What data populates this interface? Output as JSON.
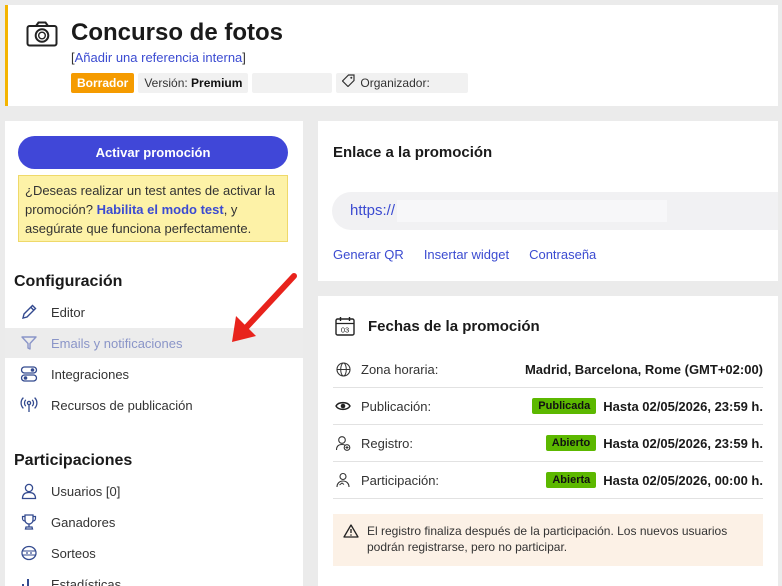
{
  "header": {
    "title": "Concurso de fotos",
    "ref_open": "[",
    "ref_link": "Añadir una referencia interna",
    "ref_close": "]",
    "badge_status": "Borrador",
    "version_label": "Versión:",
    "version_value": "Premium",
    "organizer_label": "Organizador:"
  },
  "sidebar": {
    "activate_button": "Activar promoción",
    "notice_text_1": "¿Deseas realizar un test antes de activar la promoción?",
    "notice_link": "Habilita el modo test",
    "notice_text_2": ", y asegúrate que funciona perfectamente.",
    "config_title": "Configuración",
    "config_items": [
      {
        "label": "Editor",
        "icon": "pencil-icon"
      },
      {
        "label": "Emails y notificaciones",
        "icon": "send-icon"
      },
      {
        "label": "Integraciones",
        "icon": "toggles-icon"
      },
      {
        "label": "Recursos de publicación",
        "icon": "broadcast-icon"
      }
    ],
    "part_title": "Participaciones",
    "part_items": [
      {
        "label": "Usuarios [0]",
        "icon": "user-icon"
      },
      {
        "label": "Ganadores",
        "icon": "trophy-icon"
      },
      {
        "label": "Sorteos",
        "icon": "draw-icon"
      },
      {
        "label": "Estadísticas",
        "icon": "stats-icon"
      }
    ]
  },
  "link_card": {
    "title": "Enlace a la promoción",
    "url_prefix": "https://",
    "actions": [
      "Generar QR",
      "Insertar widget",
      "Contraseña"
    ]
  },
  "dates_card": {
    "title": "Fechas de la promoción",
    "calendar_day": "03",
    "rows": [
      {
        "label": "Zona horaria:",
        "value": "Madrid, Barcelona, Rome (GMT+02:00)",
        "badge": "",
        "icon": "globe-icon"
      },
      {
        "label": "Publicación:",
        "value": "Hasta 02/05/2026, 23:59 h.",
        "badge": "Publicada",
        "icon": "eye-icon"
      },
      {
        "label": "Registro:",
        "value": "Hasta 02/05/2026, 23:59 h.",
        "badge": "Abierto",
        "icon": "user-add-icon"
      },
      {
        "label": "Participación:",
        "value": "Hasta 02/05/2026, 00:00 h.",
        "badge": "Abierta",
        "icon": "hand-icon"
      }
    ],
    "warning": "El registro finaliza después de la participación. Los nuevos usuarios podrán registrarse, pero no participar."
  },
  "colors": {
    "accent": "#4047d8",
    "draft": "#f59b00",
    "status_green": "#5cb800",
    "arrow": "#e8231c"
  }
}
